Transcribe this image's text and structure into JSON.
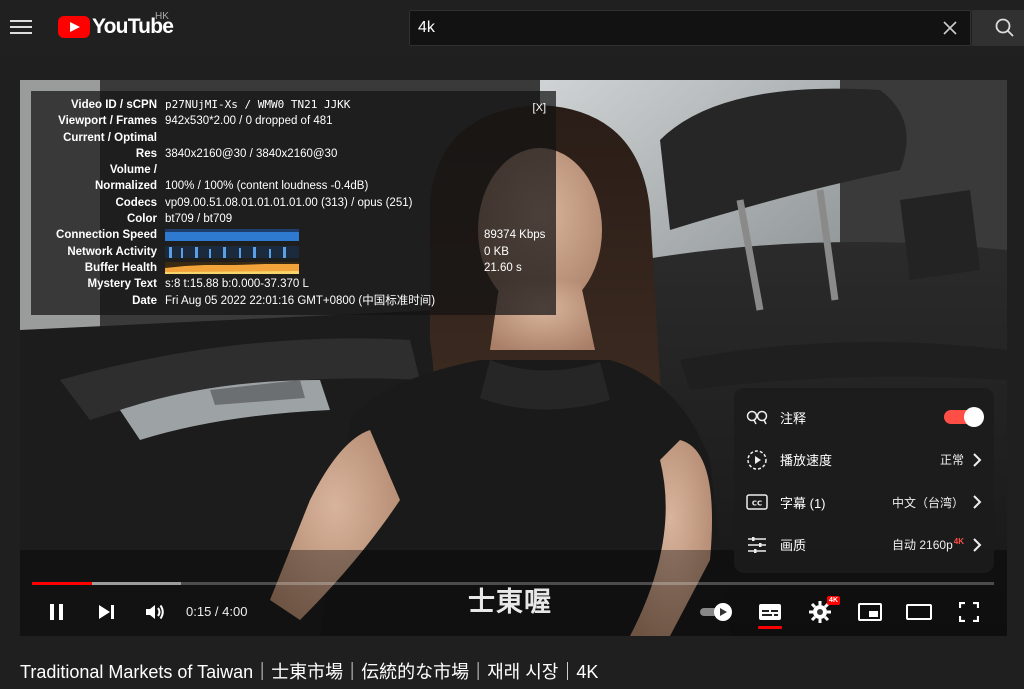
{
  "header": {
    "logo_text": "YouTube",
    "region": "HK",
    "search_value": "4k",
    "search_placeholder": "Search"
  },
  "stats": {
    "close_label": "[X]",
    "rows": [
      {
        "label": "Video ID / sCPN",
        "value": "p27NUjMI-Xs / WMW0 TN21 JJKK"
      },
      {
        "label": "Viewport / Frames",
        "value": "942x530*2.00 / 0 dropped of 481"
      },
      {
        "label": "Current / Optimal",
        "value": ""
      },
      {
        "label": "Res",
        "value": "3840x2160@30 / 3840x2160@30"
      },
      {
        "label": "Volume /",
        "value": ""
      },
      {
        "label": "Normalized",
        "value": "100% / 100% (content loudness -0.4dB)"
      },
      {
        "label": "Codecs",
        "value": "vp09.00.51.08.01.01.01.01.00 (313) / opus (251)"
      },
      {
        "label": "Color",
        "value": "bt709 / bt709"
      }
    ],
    "graph_rows": [
      {
        "label": "Connection Speed",
        "value": "89374 Kbps"
      },
      {
        "label": "Network Activity",
        "value": "0 KB"
      },
      {
        "label": "Buffer Health",
        "value": "21.60 s"
      }
    ],
    "tail_rows": [
      {
        "label": "Mystery Text",
        "value": "s:8 t:15.88 b:0.000-37.370 L"
      },
      {
        "label": "Date",
        "value": "Fri Aug 05 2022 22:01:16 GMT+0800 (中国标准时间)"
      }
    ]
  },
  "subtitle_text": "士東喔",
  "settings": {
    "annotations_label": "注释",
    "annotations_on": true,
    "speed_label": "播放速度",
    "speed_value": "正常",
    "captions_label": "字幕 (1)",
    "captions_value": "中文（台湾）",
    "quality_label": "画质",
    "quality_value": "自动 2160p",
    "quality_badge": "4K"
  },
  "player": {
    "time_display": "0:15 / 4:00",
    "played_fraction": 0.0625,
    "loaded_fraction": 0.155,
    "settings_badge": "4K"
  },
  "video": {
    "title": "Traditional Markets of Taiwan｜士東市場｜伝統的な市場｜재래 시장｜4K"
  },
  "colors": {
    "accent": "#ff0000",
    "toggle_on": "#ff4e45",
    "background": "#1f1f1f"
  }
}
